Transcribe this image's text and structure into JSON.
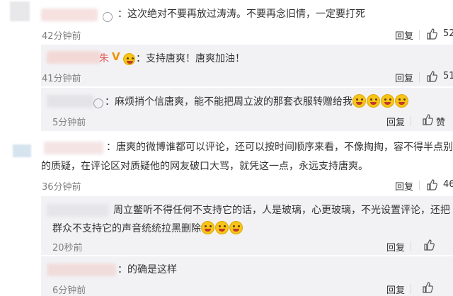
{
  "comments": [
    {
      "text": "：这次绝对不要再放过涛涛。不要再念旧情，一定要打死",
      "time": "42分钟前",
      "reply": "回复",
      "likes": "52"
    },
    {
      "text": "：支持唐爽！唐爽加油！",
      "time": "41分钟前",
      "reply": "回复",
      "likes": "51"
    },
    {
      "text": "：麻烦捎个信唐爽，能不能把周立波的那套衣服转赠给我",
      "time": "5分钟前",
      "reply": "回复",
      "likes": "赞"
    },
    {
      "text_line1": "：唐爽的微博谁都可以评论，还可以按时间顺序来看，不像掏掏，容不得半点别人",
      "text_line2": "的质疑，在评论区对质疑他的网友破口大骂，就凭这一点，永远支持唐爽。",
      "time": "36分钟前",
      "reply": "回复",
      "likes": "46"
    },
    {
      "text_line1": "周立鳖听不得任何不支持它的话，人是玻璃，心更玻璃，不光设置评论，还把",
      "text_line2": "群众不支持它的声音统统拉黑删除",
      "time": "20秒前",
      "reply": "回复",
      "likes": ""
    },
    {
      "text": "：的确是这样",
      "time": "6分钟前",
      "reply": "回复",
      "likes": ""
    }
  ],
  "colors": {
    "panel_bg": "#f2f2f5",
    "time_text": "#808080",
    "emoji_yellow": "#f5c518",
    "badge_orange": "#f29100"
  }
}
